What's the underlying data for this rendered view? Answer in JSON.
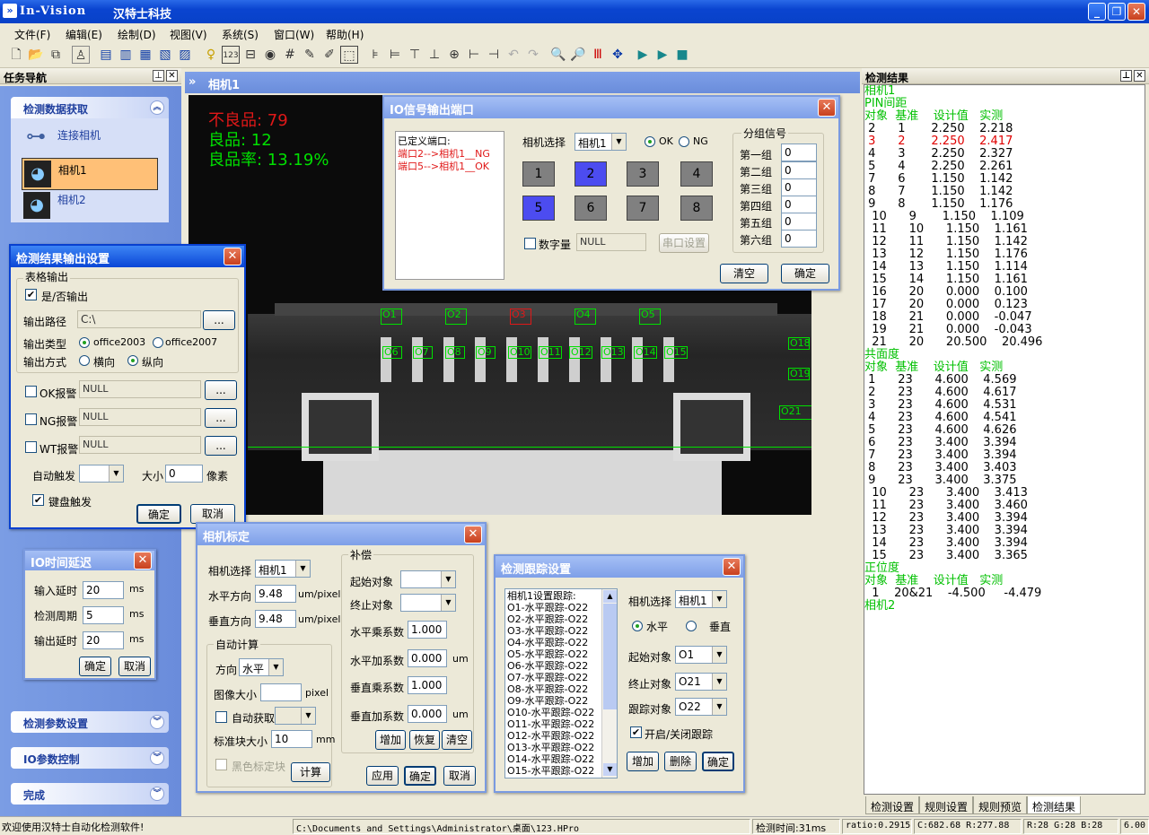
{
  "app": {
    "title": "In-Vision",
    "company": "汉特士科技"
  },
  "menu": [
    "文件(F)",
    "编辑(E)",
    "绘制(D)",
    "视图(V)",
    "系统(S)",
    "窗口(W)",
    "帮助(H)"
  ],
  "nav": {
    "title": "任务导航",
    "sec_acquire": "检测数据获取",
    "connect": "连接相机",
    "cam1": "相机1",
    "cam2": "相机2",
    "sec_params": "检测参数设置",
    "sec_io": "IO参数控制",
    "sec_done": "完成"
  },
  "camera": {
    "title": "相机1",
    "ng_text": "不良品: 79",
    "ok_text": "良品:  12",
    "rate_text": "良品率:  13.19%",
    "overlays": [
      "O1",
      "O2",
      "O3",
      "O4",
      "O5",
      "O6",
      "O7",
      "O8",
      "O9",
      "O10",
      "O11",
      "O12",
      "O13",
      "O14",
      "O15",
      "O18",
      "O19",
      "O21"
    ]
  },
  "io_dialog": {
    "title": "IO信号输出端口",
    "defined_label": "已定义端口:",
    "port_a": "端口2-->相机1__NG",
    "port_b": "端口5-->相机1__OK",
    "cam_label": "相机选择",
    "cam_value": "相机1",
    "ok_label": "OK",
    "ng_label": "NG",
    "buttons": [
      "1",
      "2",
      "3",
      "4",
      "5",
      "6",
      "7",
      "8"
    ],
    "digital_label": "数字量",
    "digital_value": "NULL",
    "serial_btn": "串口设置",
    "group_title": "分组信号",
    "groups": [
      {
        "label": "第一组",
        "value": "0"
      },
      {
        "label": "第二组",
        "value": "0"
      },
      {
        "label": "第三组",
        "value": "0"
      },
      {
        "label": "第四组",
        "value": "0"
      },
      {
        "label": "第五组",
        "value": "0"
      },
      {
        "label": "第六组",
        "value": "0"
      }
    ],
    "clear": "清空",
    "ok": "确定"
  },
  "output_dialog": {
    "title": "检测结果输出设置",
    "table_group": "表格输出",
    "yesno": "是/否输出",
    "path_label": "输出路径",
    "path_value": "C:\\",
    "browse": "...",
    "type_label": "输出类型",
    "type_a": "office2003",
    "type_b": "office2007",
    "mode_label": "输出方式",
    "mode_a": "横向",
    "mode_b": "纵向",
    "ok_alarm": "OK报警",
    "ng_alarm": "NG报警",
    "wt_alarm": "WT报警",
    "null": "NULL",
    "auto_label": "自动触发",
    "size_label": "大小",
    "size_value": "0",
    "pixel": "像素",
    "keyboard": "键盘触发",
    "ok": "确定",
    "cancel": "取消"
  },
  "io_delay": {
    "title": "IO时间延迟",
    "in_label": "输入延时",
    "in_value": "20",
    "period_label": "检测周期",
    "period_value": "5",
    "out_label": "输出延时",
    "out_value": "20",
    "unit": "ms",
    "ok": "确定",
    "cancel": "取消"
  },
  "calib": {
    "title": "相机标定",
    "cam_label": "相机选择",
    "cam_value": "相机1",
    "h_label": "水平方向",
    "h_value": "9.48",
    "h_unit": "um/pixel",
    "v_label": "垂直方向",
    "v_value": "9.48",
    "v_unit": "um/pixel",
    "auto_group": "自动计算",
    "dir_label": "方向",
    "dir_value": "水平",
    "imgsize_label": "图像大小",
    "imgsize_unit": "pixel",
    "auto_get": "自动获取",
    "block_label": "标准块大小",
    "block_value": "10",
    "block_unit": "mm",
    "black": "黑色标定块",
    "calc": "计算",
    "comp_group": "补偿",
    "start_label": "起始对象",
    "end_label": "终止对象",
    "hm_label": "水平乘系数",
    "hm_value": "1.000",
    "ha_label": "水平加系数",
    "ha_value": "0.000",
    "ha_unit": "um",
    "vm_label": "垂直乘系数",
    "vm_value": "1.000",
    "va_label": "垂直加系数",
    "va_value": "0.000",
    "va_unit": "um",
    "add": "增加",
    "restore": "恢复",
    "clear": "清空",
    "apply": "应用",
    "ok": "确定",
    "cancel": "取消"
  },
  "track": {
    "title": "检测跟踪设置",
    "list_header": "相机1设置跟踪:",
    "items": [
      "O1-水平跟踪-O22",
      "O2-水平跟踪-O22",
      "O3-水平跟踪-O22",
      "O4-水平跟踪-O22",
      "O5-水平跟踪-O22",
      "O6-水平跟踪-O22",
      "O7-水平跟踪-O22",
      "O8-水平跟踪-O22",
      "O9-水平跟踪-O22",
      "O10-水平跟踪-O22",
      "O11-水平跟踪-O22",
      "O12-水平跟踪-O22",
      "O13-水平跟踪-O22",
      "O14-水平跟踪-O22",
      "O15-水平跟踪-O22"
    ],
    "cam_label": "相机选择",
    "cam_value": "相机1",
    "h_label": "水平",
    "v_label": "垂直",
    "start_label": "起始对象",
    "start_value": "O1",
    "end_label": "终止对象",
    "end_value": "O21",
    "trk_label": "跟踪对象",
    "trk_value": "O22",
    "toggle": "开启/关闭跟踪",
    "add": "增加",
    "del": "删除",
    "ok": "确定"
  },
  "results": {
    "title": "检测结果",
    "lines": [
      {
        "t": "相机1",
        "c": "#00c000"
      },
      {
        "t": "PIN间距",
        "c": "#00c000"
      },
      {
        "t": "对象  基准    设计值   实测",
        "c": "#00c000"
      },
      {
        "t": " 2      1       2.250    2.218",
        "c": "#000"
      },
      {
        "t": " 3      2       2.250    2.417",
        "c": "#e00000"
      },
      {
        "t": " 4      3       2.250    2.327",
        "c": "#000"
      },
      {
        "t": " 5      4       2.250    2.261",
        "c": "#000"
      },
      {
        "t": " 7      6       1.150    1.142",
        "c": "#000"
      },
      {
        "t": " 8      7       1.150    1.142",
        "c": "#000"
      },
      {
        "t": " 9      8       1.150    1.176",
        "c": "#000"
      },
      {
        "t": "  10      9       1.150    1.109",
        "c": "#000"
      },
      {
        "t": "  11      10      1.150    1.161",
        "c": "#000"
      },
      {
        "t": "  12      11      1.150    1.142",
        "c": "#000"
      },
      {
        "t": "  13      12      1.150    1.176",
        "c": "#000"
      },
      {
        "t": "  14      13      1.150    1.114",
        "c": "#000"
      },
      {
        "t": "  15      14      1.150    1.161",
        "c": "#000"
      },
      {
        "t": "  16      20      0.000    0.100",
        "c": "#000"
      },
      {
        "t": "  17      20      0.000    0.123",
        "c": "#000"
      },
      {
        "t": "  18      21      0.000    -0.047",
        "c": "#000"
      },
      {
        "t": "  19      21      0.000    -0.043",
        "c": "#000"
      },
      {
        "t": "  21      20      20.500    20.496",
        "c": "#000"
      },
      {
        "t": "共面度",
        "c": "#00c000"
      },
      {
        "t": "对象  基准    设计值   实测",
        "c": "#00c000"
      },
      {
        "t": " 1      23      4.600    4.569",
        "c": "#000"
      },
      {
        "t": " 2      23      4.600    4.617",
        "c": "#000"
      },
      {
        "t": " 3      23      4.600    4.531",
        "c": "#000"
      },
      {
        "t": " 4      23      4.600    4.541",
        "c": "#000"
      },
      {
        "t": " 5      23      4.600    4.626",
        "c": "#000"
      },
      {
        "t": " 6      23      3.400    3.394",
        "c": "#000"
      },
      {
        "t": " 7      23      3.400    3.394",
        "c": "#000"
      },
      {
        "t": " 8      23      3.400    3.403",
        "c": "#000"
      },
      {
        "t": " 9      23      3.400    3.375",
        "c": "#000"
      },
      {
        "t": "  10      23      3.400    3.413",
        "c": "#000"
      },
      {
        "t": "  11      23      3.400    3.460",
        "c": "#000"
      },
      {
        "t": "  12      23      3.400    3.394",
        "c": "#000"
      },
      {
        "t": "  13      23      3.400    3.394",
        "c": "#000"
      },
      {
        "t": "  14      23      3.400    3.394",
        "c": "#000"
      },
      {
        "t": "  15      23      3.400    3.365",
        "c": "#000"
      },
      {
        "t": "正位度",
        "c": "#00c000"
      },
      {
        "t": "对象  基准    设计值   实测",
        "c": "#00c000"
      },
      {
        "t": "  1    20&21    -4.500     -4.479",
        "c": "#000"
      },
      {
        "t": "相机2",
        "c": "#00c000"
      }
    ],
    "tabs": [
      "检测设置",
      "规则设置",
      "规则预览",
      "检测结果"
    ]
  },
  "status": {
    "welcome": "欢迎使用汉特士自动化检测软件!",
    "path": "C:\\Documents and Settings\\Administrator\\桌面\\123.HPro",
    "time": "检测时间:31ms",
    "ratio": "ratio:0.2915",
    "coord": "C:682.68 R:277.88",
    "rgb": "R:28 G:28 B:28",
    "ver": "6.00"
  },
  "colors": {
    "ng": "#e01818",
    "ok": "#00e000",
    "xp_blue": "#0a46d6"
  }
}
